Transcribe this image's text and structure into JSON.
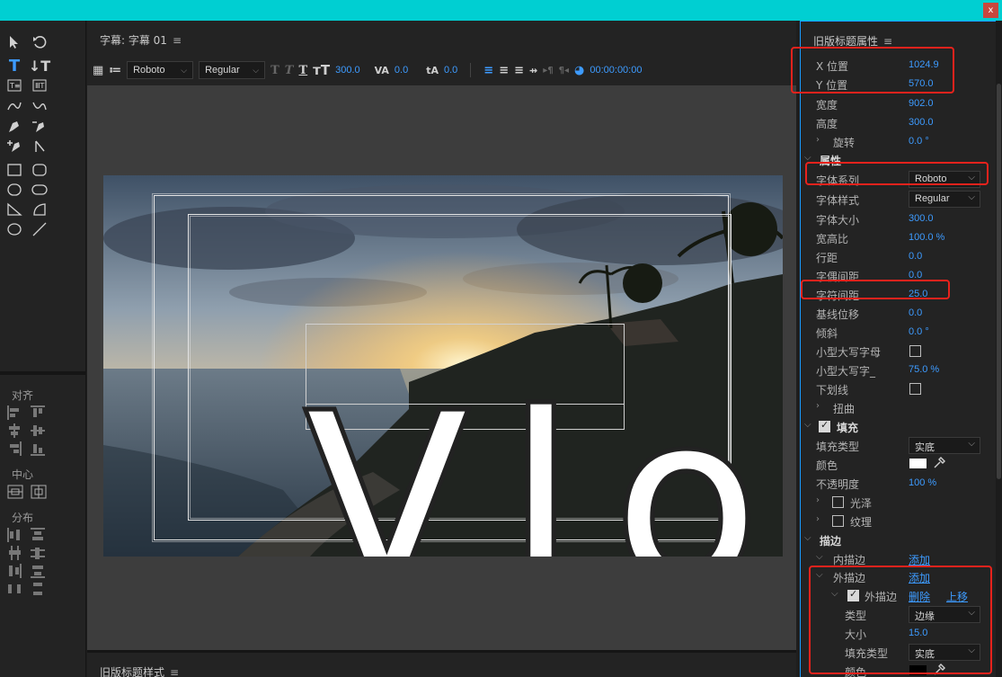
{
  "window": {
    "close_label": "x"
  },
  "tools_panel": {
    "align_label": "对齐",
    "center_label": "中心",
    "distribute_label": "分布"
  },
  "title_panel": {
    "title": "字幕: 字幕 01",
    "menu_icon": "≡",
    "toolbar": {
      "font_family": "Roboto",
      "font_style": "Regular",
      "font_size": "300.0",
      "kerning": "0.0",
      "baseline": "0.0",
      "timecode": "00:00:00:00"
    },
    "canvas_text": "Vlog"
  },
  "styles_panel": {
    "title": "旧版标题样式",
    "menu_icon": "≡"
  },
  "properties": {
    "title": "旧版标题属性",
    "menu_icon": "≡",
    "x_label": "X 位置",
    "x_value": "1024.9",
    "y_label": "Y 位置",
    "y_value": "570.0",
    "width_label": "宽度",
    "width_value": "902.0",
    "height_label": "高度",
    "height_value": "300.0",
    "rotation_label": "旋转",
    "rotation_value": "0.0 °",
    "attributes_label": "属性",
    "font_family_label": "字体系列",
    "font_family_value": "Roboto",
    "font_style_label": "字体样式",
    "font_style_value": "Regular",
    "font_size_label": "字体大小",
    "font_size_value": "300.0",
    "aspect_label": "宽高比",
    "aspect_value": "100.0",
    "aspect_unit": "%",
    "leading_label": "行距",
    "leading_value": "0.0",
    "kerning_label": "字偶间距",
    "kerning_value": "0.0",
    "tracking_label": "字符间距",
    "tracking_value": "25.0",
    "baseline_label": "基线位移",
    "baseline_value": "0.0",
    "slant_label": "倾斜",
    "slant_value": "0.0 °",
    "small_caps_label": "小型大写字母",
    "small_caps_size_label": "小型大写字_",
    "small_caps_size_value": "75.0",
    "small_caps_size_unit": "%",
    "underline_label": "下划线",
    "distort_label": "扭曲",
    "fill_label": "填充",
    "fill_type_label": "填充类型",
    "fill_type_value": "实底",
    "color_label": "颜色",
    "fill_color": "#ffffff",
    "opacity_label": "不透明度",
    "opacity_value": "100",
    "opacity_unit": "%",
    "sheen_label": "光泽",
    "texture_label": "纹理",
    "stroke_label": "描边",
    "inner_stroke_label": "内描边",
    "inner_stroke_add": "添加",
    "outer_stroke_label": "外描边",
    "outer_stroke_add": "添加",
    "outer_stroke_item_label": "外描边",
    "delete_label": "删除",
    "move_up_label": "上移",
    "type_label": "类型",
    "type_value": "边缘",
    "size_label": "大小",
    "size_value": "15.0",
    "stroke_fill_type_label": "填充类型",
    "stroke_fill_type_value": "实底",
    "stroke_color_label": "颜色",
    "stroke_color": "#000000"
  },
  "colors": {
    "accent": "#3d9bff",
    "highlight": "#e8221c",
    "top_bar": "#00cfd2"
  }
}
